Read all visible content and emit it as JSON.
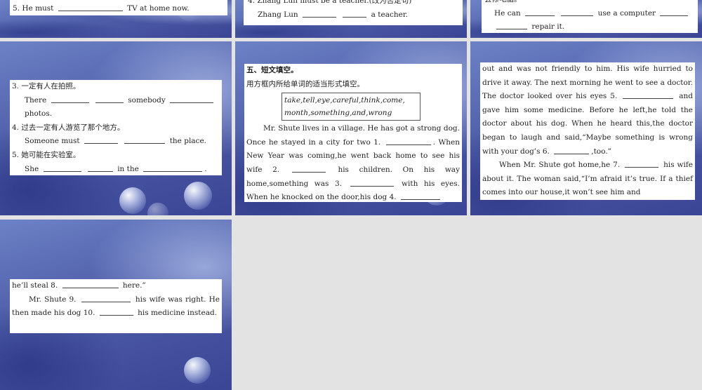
{
  "slide1": {
    "line": [
      "5. He must",
      "TV at home now."
    ]
  },
  "slide2": {
    "line1": "4. Zhang Lun must be a teacher.(改为否定句)",
    "line2": [
      "Zhang Lun",
      "a teacher."
    ]
  },
  "slide3": {
    "line1": "会修电脑。",
    "line2": [
      "He can",
      "use a computer"
    ],
    "line3": "repair it."
  },
  "slide4": {
    "q3": "3. 一定有人在拍照。",
    "q3_en": [
      "There",
      "somebody"
    ],
    "q3_end": "photos.",
    "q4": "4. 过去一定有人游览了那个地方。",
    "q4_en": [
      "Someone must",
      "the place."
    ],
    "q5": "5. 她可能在实验室。",
    "q5_en": [
      "She",
      "in the",
      "."
    ]
  },
  "slide5": {
    "heading": "五、短文填空。",
    "instruction": "用方框内所给单词的适当形式填空。",
    "word_box": [
      "take,tell,eye,careful,think,come,",
      "month,something,and,wrong"
    ],
    "p1": "Mr. Shute lives in a village. He has got a strong dog. Once he stayed in a city for two 1.",
    "p2": "When New Year was coming,he went back home to see his wife 2.",
    "p3": "his children. On his way home,something was 3.",
    "p4": "with his eyes. When he knocked on the door,his dog 4."
  },
  "slide6": {
    "t1": "out and was not friendly to him. His wife hurried to drive it away. The next morning he went to see a doctor. The doctor looked over his eyes 5.",
    "t2": "and gave him some medicine. Before he left,he told the doctor about his dog. When he heard this,the doctor began to laugh and said,“Maybe something is wrong with your dog’s 6.",
    "t3": ",too.”",
    "t4": "When Mr. Shute got home,he 7.",
    "t5": "his wife about it. The woman said,“I’m afraid it’s true. If a thief comes into our house,it won’t see him and"
  },
  "slide7": {
    "t1": "he’ll steal 8.",
    "t2": "here.”",
    "t3": "Mr. Shute 9.",
    "t4": "his wife was right. He then made his dog 10.",
    "t5": "his medicine instead."
  }
}
